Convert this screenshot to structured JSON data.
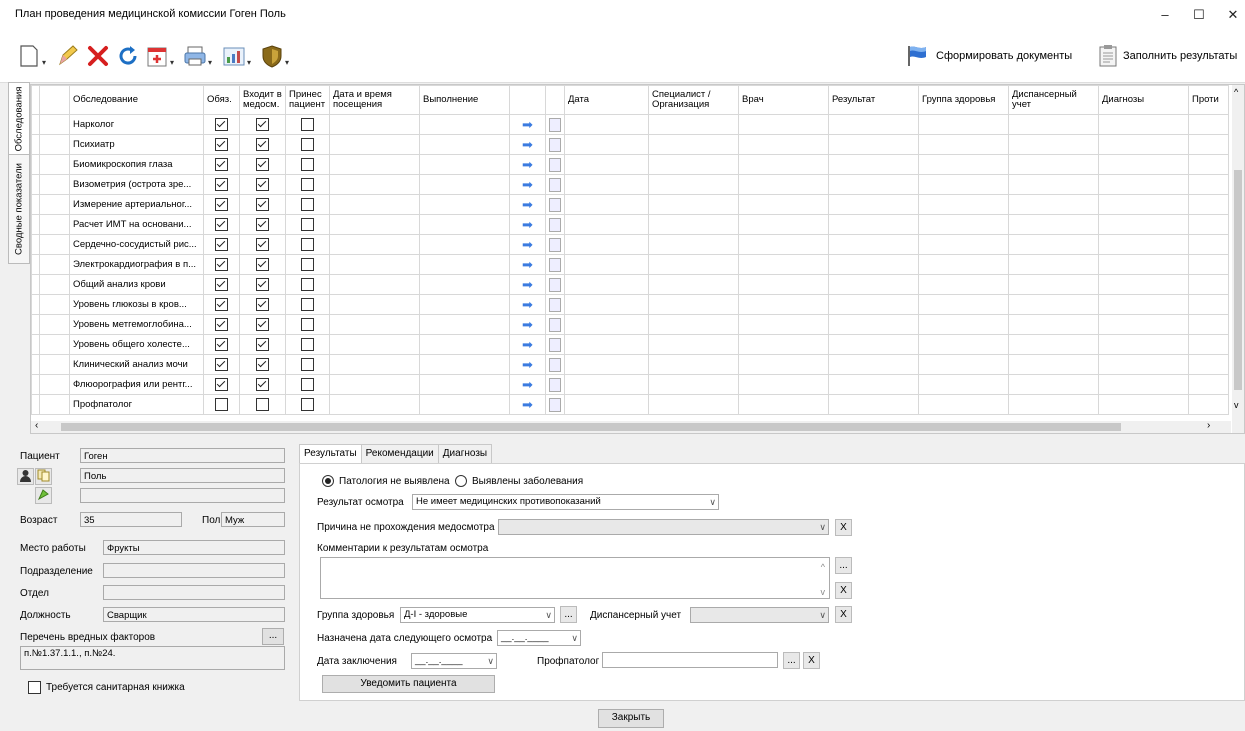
{
  "window": {
    "title": "План проведения медицинской комиссии Гоген Поль",
    "minimize": "–",
    "maximize": "☐",
    "close": "✕"
  },
  "toolbar": {
    "generate_docs": "Сформировать документы",
    "fill_results": "Заполнить результаты"
  },
  "side_tabs": {
    "exams": "Обследования",
    "summary": "Сводные показатели"
  },
  "grid": {
    "headers": [
      "Обследование",
      "Обяз.",
      "Входит в медосм.",
      "Принес пациент",
      "Дата и время посещения",
      "Выполнение",
      "",
      "",
      "Дата",
      "Специалист / Организация",
      "Врач",
      "Результат",
      "Группа здоровья",
      "Диспансерный учет",
      "Диагнозы",
      "Проти"
    ],
    "rows": [
      {
        "name": "Нарколог",
        "req": true,
        "incl": true,
        "brought": false
      },
      {
        "name": "Психиатр",
        "req": true,
        "incl": true,
        "brought": false
      },
      {
        "name": "Биомикроскопия глаза",
        "req": true,
        "incl": true,
        "brought": false
      },
      {
        "name": "Визометрия (острота зре...",
        "req": true,
        "incl": true,
        "brought": false
      },
      {
        "name": "Измерение артериальног...",
        "req": true,
        "incl": true,
        "brought": false
      },
      {
        "name": "Расчет ИМТ на основани...",
        "req": true,
        "incl": true,
        "brought": false
      },
      {
        "name": "Сердечно-сосудистый рис...",
        "req": true,
        "incl": true,
        "brought": false
      },
      {
        "name": "Электрокардиография в п...",
        "req": true,
        "incl": true,
        "brought": false
      },
      {
        "name": "Общий анализ крови",
        "req": true,
        "incl": true,
        "brought": false
      },
      {
        "name": "Уровень глюкозы в кров...",
        "req": true,
        "incl": true,
        "brought": false
      },
      {
        "name": "Уровень метгемоглобина...",
        "req": true,
        "incl": true,
        "brought": false
      },
      {
        "name": "Уровень общего холесте...",
        "req": true,
        "incl": true,
        "brought": false
      },
      {
        "name": "Клинический анализ мочи",
        "req": true,
        "incl": true,
        "brought": false
      },
      {
        "name": "Флюорография или рентг...",
        "req": true,
        "incl": true,
        "brought": false
      },
      {
        "name": "Профпатолог",
        "req": false,
        "incl": false,
        "brought": false
      }
    ]
  },
  "patient": {
    "label_patient": "Пациент",
    "last_name": "Гоген",
    "first_name": "Поль",
    "label_age": "Возраст",
    "age": "35",
    "label_sex": "Пол",
    "sex": "Муж",
    "label_workplace": "Место работы",
    "workplace": "Фрукты",
    "label_division": "Подразделение",
    "label_department": "Отдел",
    "label_position": "Должность",
    "position": "Сварщик",
    "label_hazards": "Перечень вредных факторов",
    "hazards": "п.№1.37.1.1., п.№24.",
    "sanitary_book": "Требуется санитарная книжка",
    "ellipsis": "..."
  },
  "tabs": {
    "results": "Результаты",
    "recommendations": "Рекомендации",
    "diagnoses": "Диагнозы"
  },
  "results": {
    "radio_no_pathology": "Патология не выявлена",
    "radio_diseases": "Выявлены заболевания",
    "label_result": "Результат осмотра",
    "result_value": "Не имеет медицинских противопоказаний",
    "label_reason": "Причина не прохождения медосмотра",
    "label_comments": "Комментарии к результатам осмотра",
    "label_health_group": "Группа здоровья",
    "health_group_value": "Д-I - здоровые",
    "label_dispensary": "Диспансерный учет",
    "label_next_date": "Назначена дата следующего осмотра",
    "next_date_value": "__.__.____",
    "label_conclusion_date": "Дата заключения",
    "conclusion_date_value": "__.__.____",
    "label_profpatolog": "Профпатолог",
    "notify_button": "Уведомить пациента",
    "clear": "X",
    "ellipsis": "..."
  },
  "footer": {
    "close_button": "Закрыть"
  },
  "icons": [
    "new-doc-icon",
    "edit-pencil-icon",
    "delete-x-icon",
    "refresh-icon",
    "medkit-icon",
    "printer-icon",
    "chart-icon",
    "shield-icon",
    "flag-icon",
    "clipboard-icon"
  ]
}
